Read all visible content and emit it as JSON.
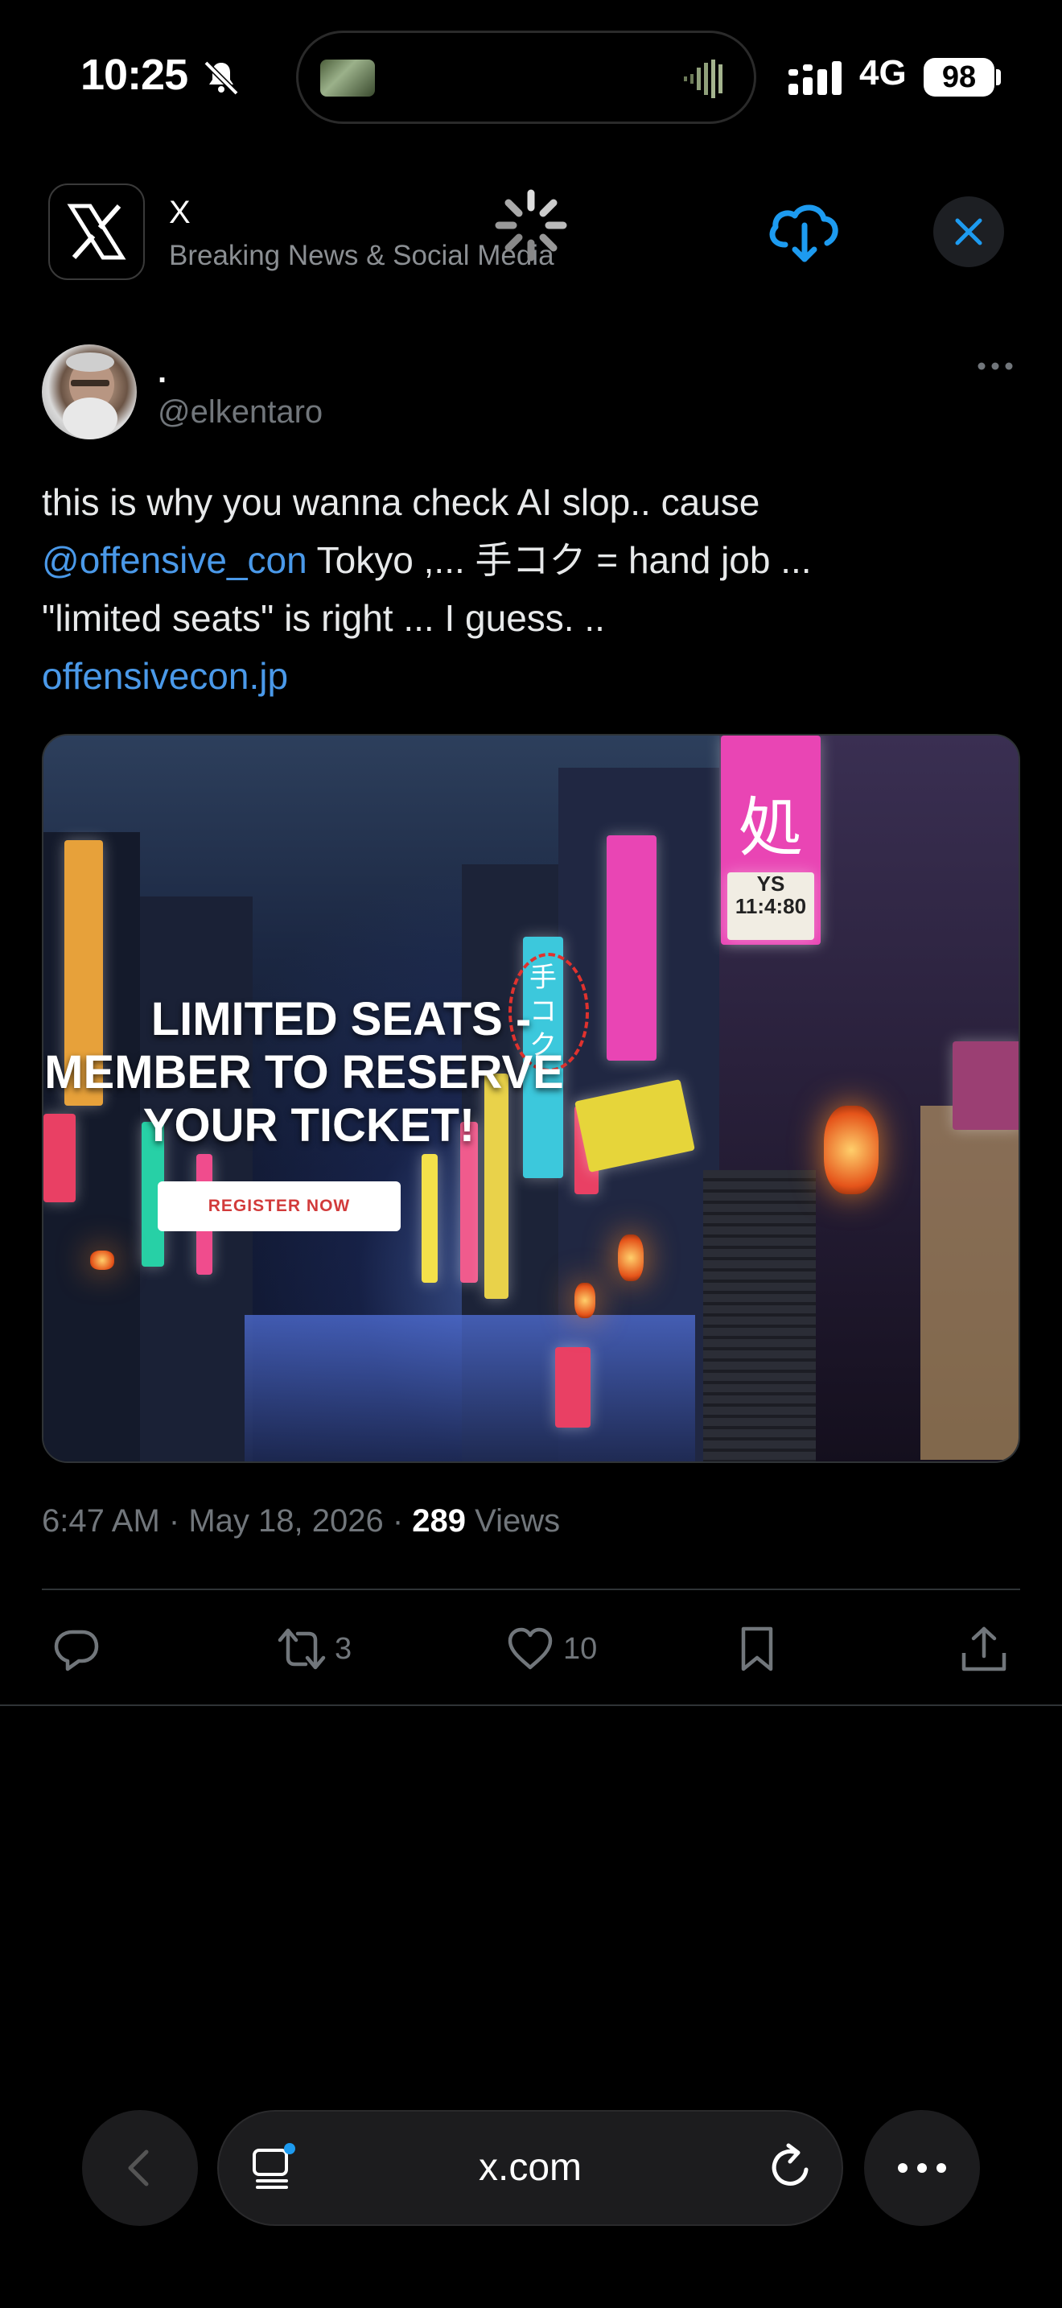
{
  "status_bar": {
    "time": "10:25",
    "network": "4G",
    "battery": "98"
  },
  "app_banner": {
    "app_name": "X",
    "app_subtitle": "Breaking News & Social Media"
  },
  "tweet": {
    "display_name": ".",
    "handle": "@elkentaro",
    "text_line1": "this is why you wanna check AI slop.. cause",
    "mention": "@offensive_con",
    "text_line2_rest": " Tokyo ,... 手コク = hand job ...",
    "text_line3": "\"limited seats\" is right ... I guess.  ..",
    "link": "offensivecon.jp",
    "image": {
      "overlay_line1": "LIMITED SEATS -",
      "overlay_line2": "MEMBER TO RESERVE",
      "overlay_line3": "YOUR TICKET!",
      "button_label": "REGISTER NOW",
      "sign_kanji": "手コク",
      "sign_right_top": "処",
      "sign_right_clock": "11:4:80",
      "sign_ys": "YS"
    },
    "time": "6:47 AM",
    "date": "May 18, 2026",
    "views_count": "289",
    "views_label": "Views",
    "retweets": "3",
    "likes": "10"
  },
  "browser": {
    "url": "x.com"
  },
  "colors": {
    "accent": "#1d9bf0",
    "link": "#4a99e9",
    "background": "#000000"
  }
}
